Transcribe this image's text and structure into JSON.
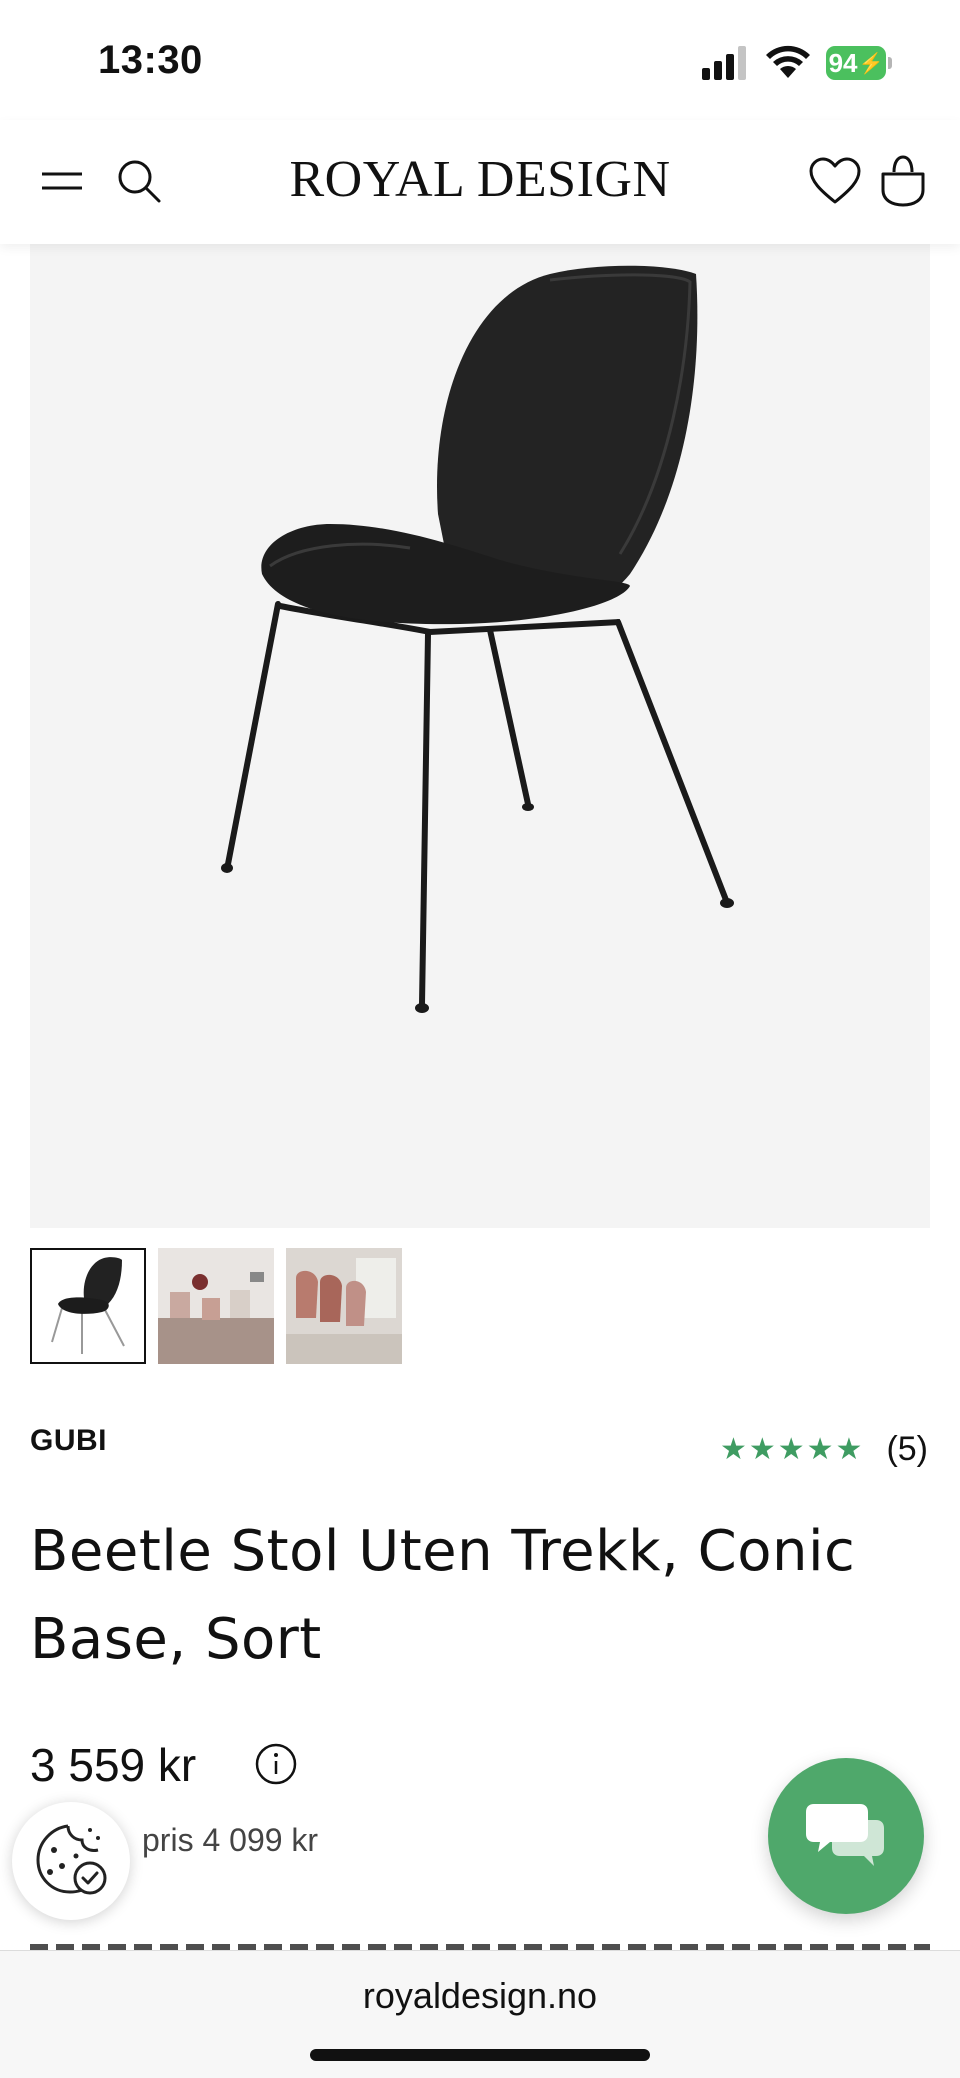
{
  "status_bar": {
    "time": "13:30",
    "battery": "94"
  },
  "header": {
    "logo": "ROYAL DESIGN",
    "icons": [
      "menu-icon",
      "search-icon",
      "heart-icon",
      "bag-icon"
    ]
  },
  "gallery": {
    "thumbnails": [
      "chair-black-thumbnail",
      "room-scene-thumbnail",
      "pink-chairs-thumbnail"
    ],
    "active_index": 0
  },
  "product": {
    "brand": "GUBI",
    "stars": "★★★★★",
    "rating_count": "(5)",
    "rating_value": 5,
    "title": "Beetle Stol Uten Trekk, Conic Base, Sort",
    "price": "3 559 kr",
    "old_price": "pris 4 099 kr"
  },
  "browser": {
    "url": "royaldesign.no"
  },
  "colors": {
    "accent_green": "#4fa86b",
    "star_green": "#3f9c62",
    "battery_green": "#4bc05e"
  }
}
